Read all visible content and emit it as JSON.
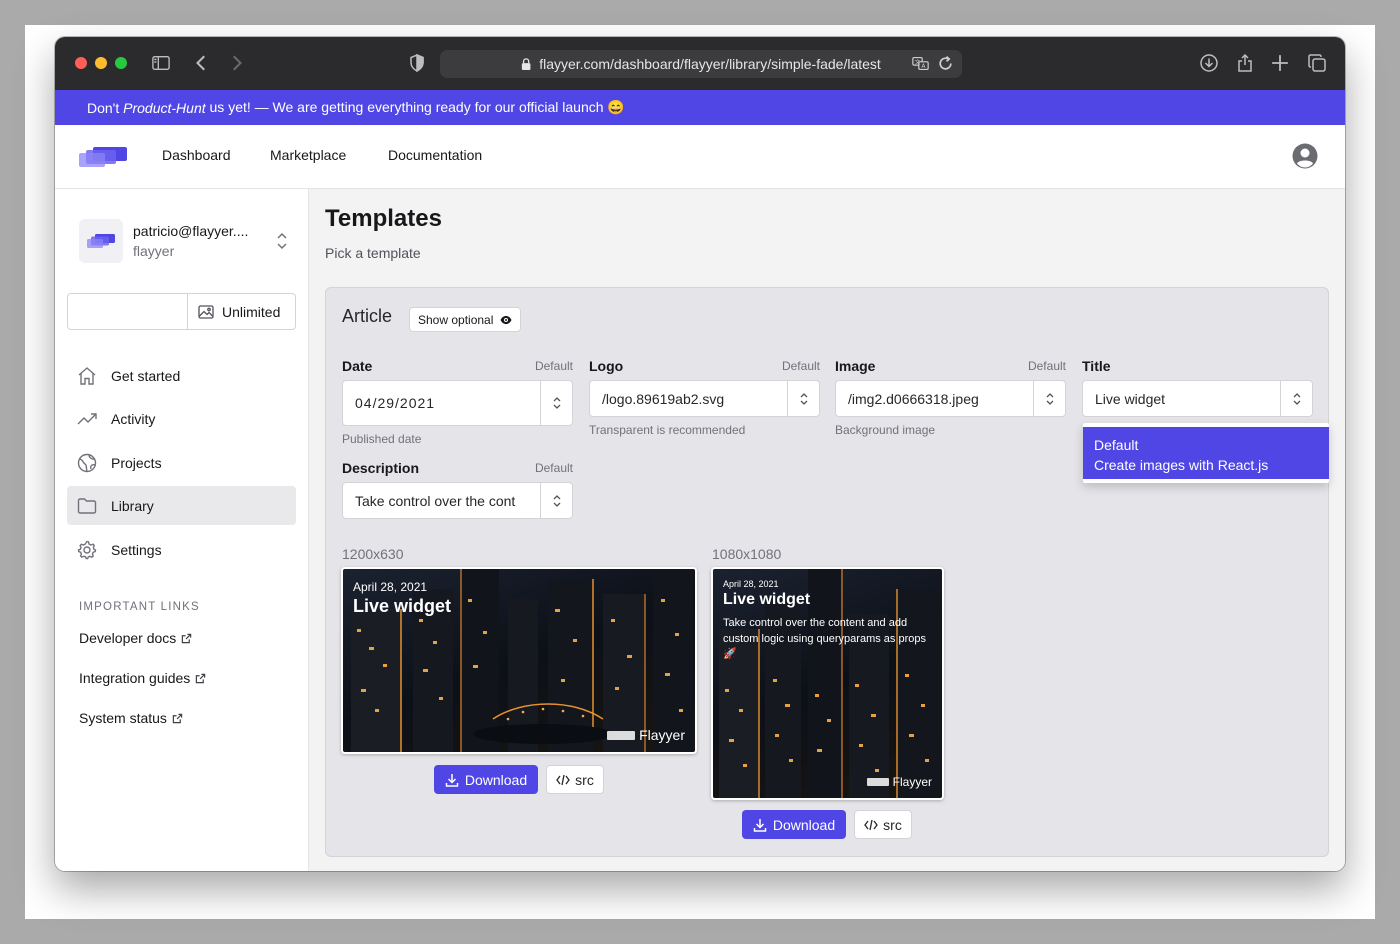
{
  "browser": {
    "url": "flayyer.com/dashboard/flayyer/library/simple-fade/latest",
    "icons": [
      "sidebar-icon",
      "back-icon",
      "forward-icon",
      "shield-icon",
      "lock-icon",
      "translate-icon",
      "reload-icon",
      "download-icon",
      "share-icon",
      "new-tab-icon",
      "tabs-icon"
    ]
  },
  "banner": {
    "prefix": "Don't ",
    "emphasis": "Product-Hunt",
    "suffix": " us yet! — We are getting everything ready for our official launch 😄"
  },
  "topnav": {
    "links": [
      "Dashboard",
      "Marketplace",
      "Documentation"
    ]
  },
  "sidebar": {
    "account": {
      "email": "patricio@flayyer....",
      "team": "flayyer"
    },
    "quota_label": "Unlimited",
    "items": [
      {
        "label": "Get started",
        "icon": "home-icon"
      },
      {
        "label": "Activity",
        "icon": "trend-icon"
      },
      {
        "label": "Projects",
        "icon": "globe-icon"
      },
      {
        "label": "Library",
        "icon": "folder-icon",
        "active": true
      },
      {
        "label": "Settings",
        "icon": "gear-icon"
      }
    ],
    "links_heading": "IMPORTANT LINKS",
    "links": [
      "Developer docs",
      "Integration guides",
      "System status"
    ]
  },
  "main": {
    "title": "Templates",
    "subtitle": "Pick a template",
    "card": {
      "title": "Article",
      "show_optional": "Show optional",
      "fields": {
        "date": {
          "label": "Date",
          "default": "Default",
          "value": "04/29/2021",
          "help": "Published date"
        },
        "logo": {
          "label": "Logo",
          "default": "Default",
          "value": "/logo.89619ab2.svg",
          "help": "Transparent is recommended"
        },
        "image": {
          "label": "Image",
          "default": "Default",
          "value": "/img2.d0666318.jpeg",
          "help": "Background image"
        },
        "title": {
          "label": "Title",
          "value": "Live widget"
        },
        "description": {
          "label": "Description",
          "default": "Default",
          "value": "Take control over the cont"
        }
      },
      "dropdown": {
        "line1": "Default",
        "line2": "Create images with React.js"
      },
      "previews": [
        {
          "size": "1200x630",
          "date": "April 28, 2021",
          "title": "Live widget",
          "brand": "Flayyer",
          "download": "Download",
          "src": "src"
        },
        {
          "size": "1080x1080",
          "date": "April 28, 2021",
          "title": "Live widget",
          "description": "Take control over the content and add custom logic using queryparams as props 🚀",
          "brand": "Flayyer",
          "download": "Download",
          "src": "src"
        }
      ]
    }
  },
  "colors": {
    "brand": "#4f46e5",
    "chrome": "#2b2b2d",
    "background": "#f3f3f4"
  }
}
